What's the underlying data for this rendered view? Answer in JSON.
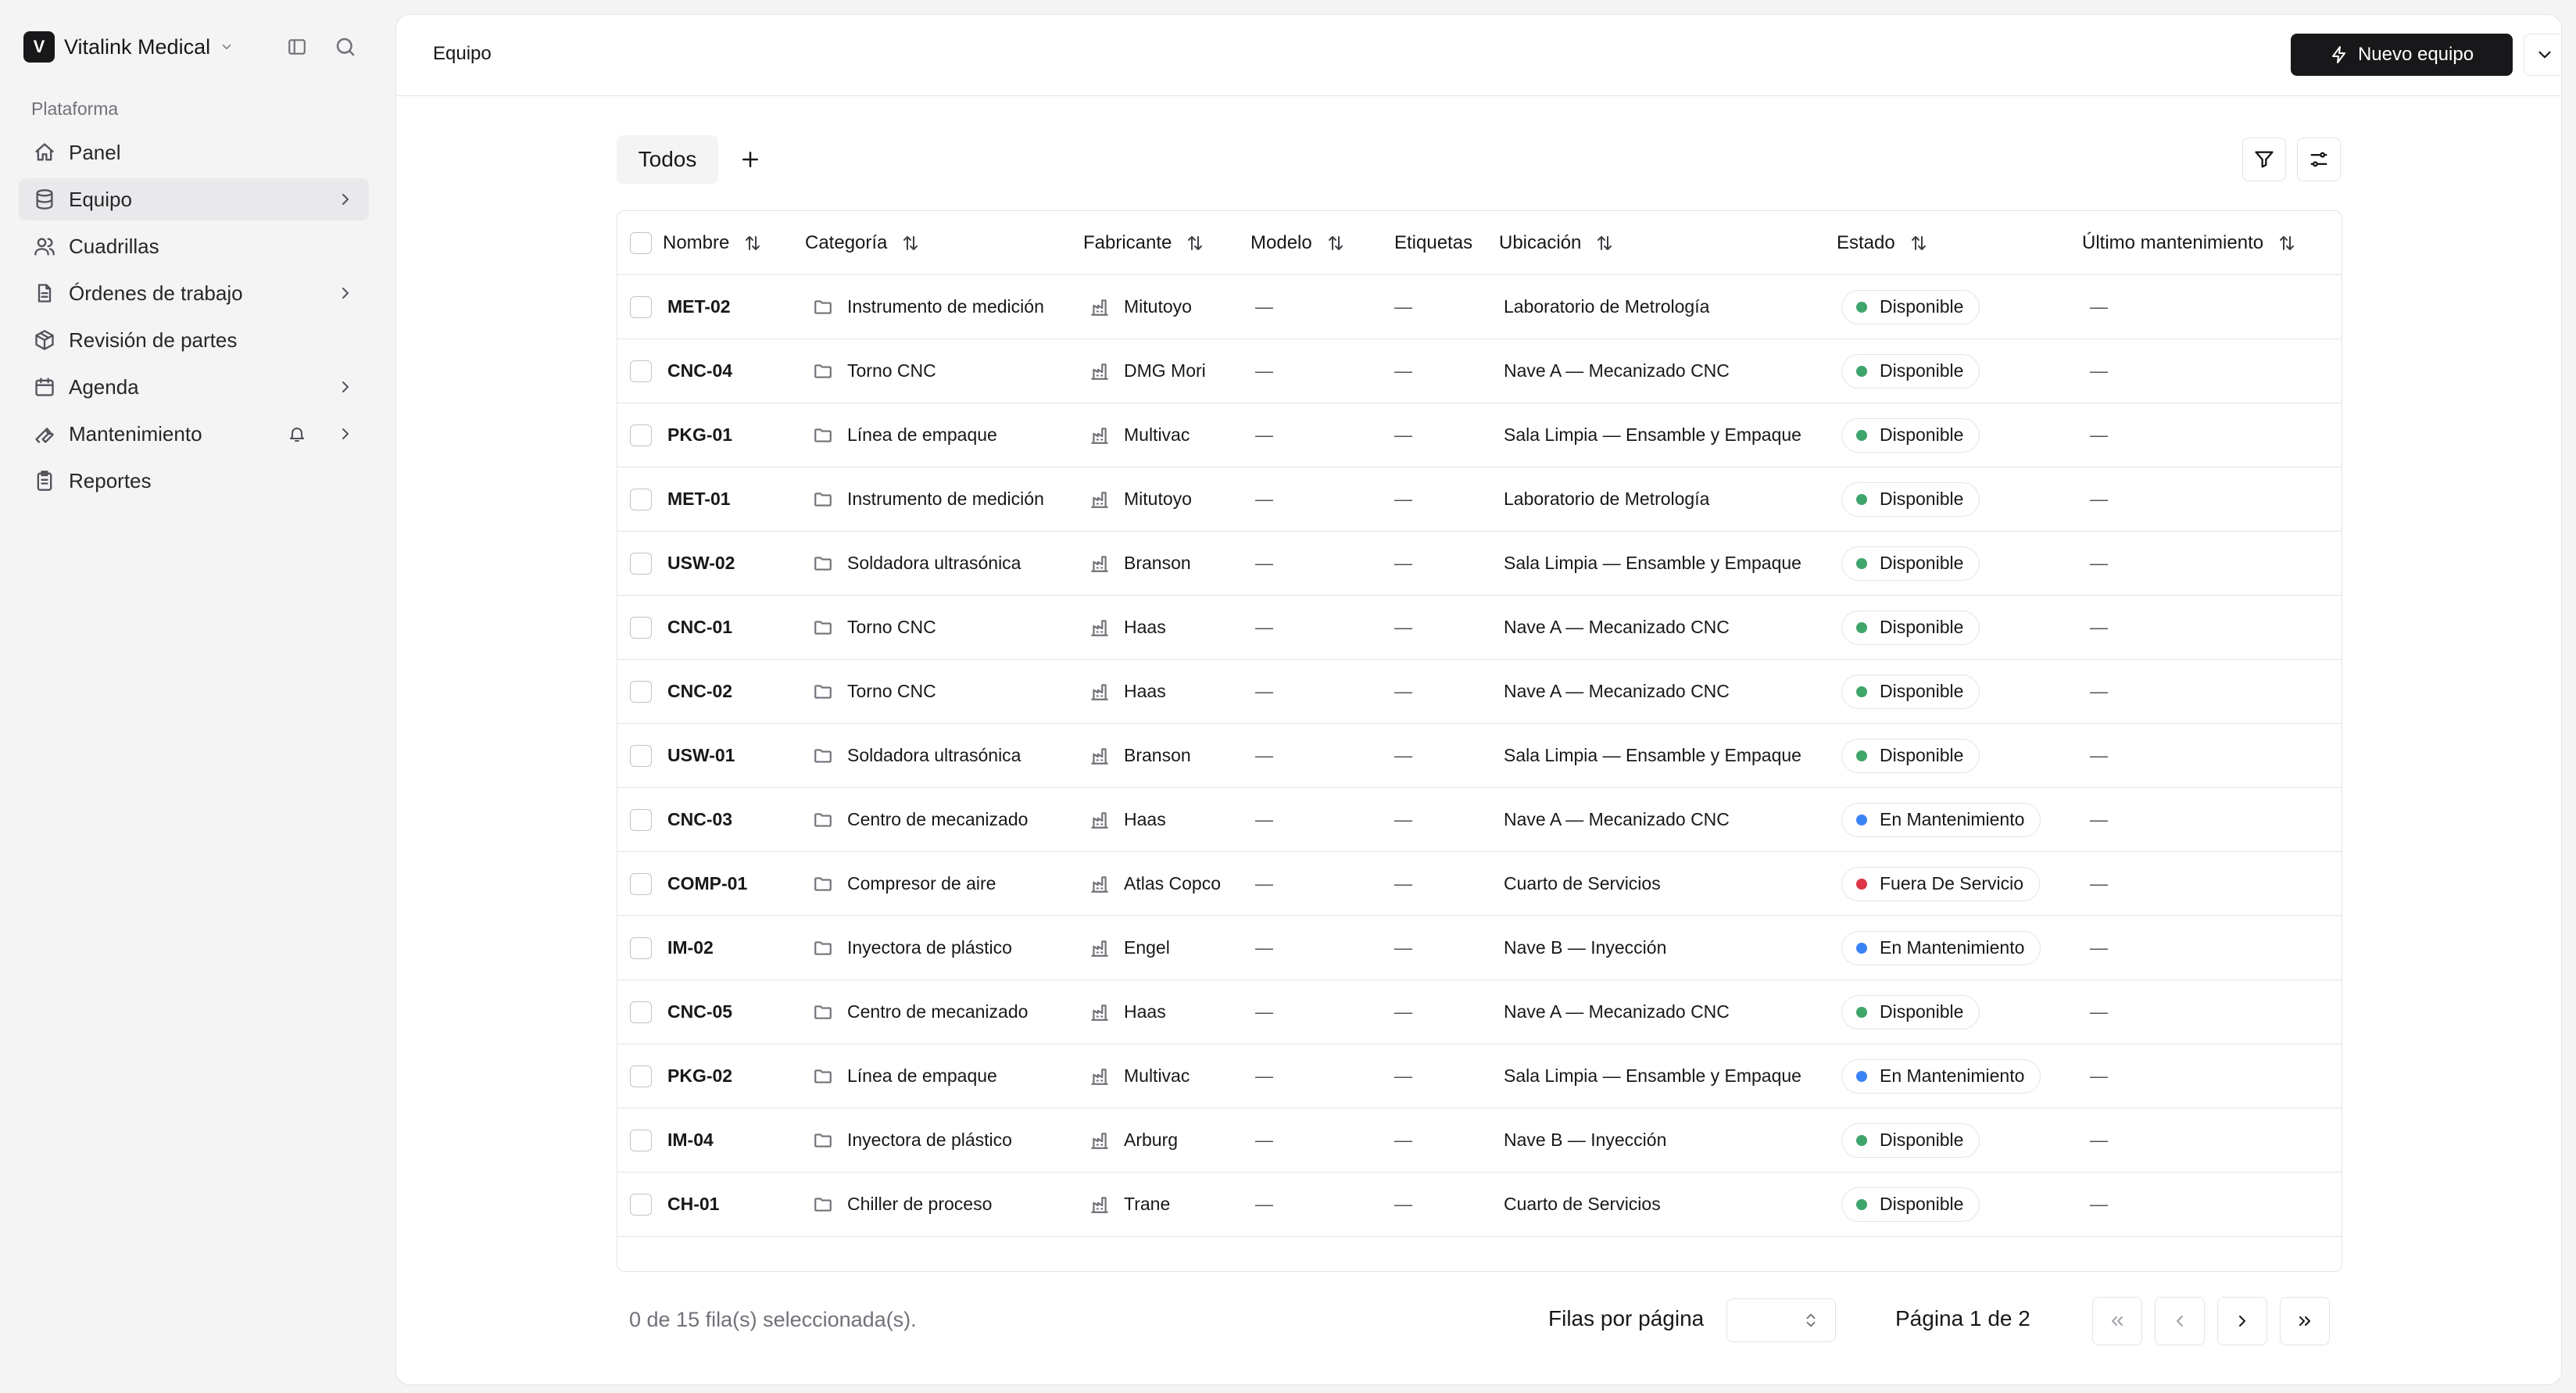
{
  "brand": {
    "initial": "V",
    "name": "Vitalink Medical"
  },
  "sidebar": {
    "section_label": "Plataforma",
    "items": [
      {
        "label": "Panel",
        "icon": "home-icon",
        "active": false,
        "chevron": false
      },
      {
        "label": "Equipo",
        "icon": "database-icon",
        "active": true,
        "chevron": true
      },
      {
        "label": "Cuadrillas",
        "icon": "users-icon",
        "active": false,
        "chevron": false
      },
      {
        "label": "Órdenes de trabajo",
        "icon": "file-text-icon",
        "active": false,
        "chevron": true
      },
      {
        "label": "Revisión de partes",
        "icon": "package-icon",
        "active": false,
        "chevron": false
      },
      {
        "label": "Agenda",
        "icon": "calendar-icon",
        "active": false,
        "chevron": true
      },
      {
        "label": "Mantenimiento",
        "icon": "wrench-icon",
        "active": false,
        "chevron": true,
        "bell": true
      },
      {
        "label": "Reportes",
        "icon": "clipboard-icon",
        "active": false,
        "chevron": false
      }
    ]
  },
  "header": {
    "breadcrumb": "Equipo",
    "new_button_label": "Nuevo equipo"
  },
  "view": {
    "tab_label": "Todos"
  },
  "table": {
    "columns": {
      "nombre": "Nombre",
      "categoria": "Categoría",
      "fabricante": "Fabricante",
      "modelo": "Modelo",
      "etiquetas": "Etiquetas",
      "ubicacion": "Ubicación",
      "estado": "Estado",
      "ultimo": "Último mantenimiento"
    },
    "rows": [
      {
        "nombre": "MET-02",
        "categoria": "Instrumento de medición",
        "fabricante": "Mitutoyo",
        "modelo": "—",
        "etiquetas": "—",
        "ubicacion": "Laboratorio de Metrología",
        "estado": "Disponible",
        "ultimo": "—"
      },
      {
        "nombre": "CNC-04",
        "categoria": "Torno CNC",
        "fabricante": "DMG Mori",
        "modelo": "—",
        "etiquetas": "—",
        "ubicacion": "Nave A — Mecanizado CNC",
        "estado": "Disponible",
        "ultimo": "—"
      },
      {
        "nombre": "PKG-01",
        "categoria": "Línea de empaque",
        "fabricante": "Multivac",
        "modelo": "—",
        "etiquetas": "—",
        "ubicacion": "Sala Limpia — Ensamble y Empaque",
        "estado": "Disponible",
        "ultimo": "—"
      },
      {
        "nombre": "MET-01",
        "categoria": "Instrumento de medición",
        "fabricante": "Mitutoyo",
        "modelo": "—",
        "etiquetas": "—",
        "ubicacion": "Laboratorio de Metrología",
        "estado": "Disponible",
        "ultimo": "—"
      },
      {
        "nombre": "USW-02",
        "categoria": "Soldadora ultrasónica",
        "fabricante": "Branson",
        "modelo": "—",
        "etiquetas": "—",
        "ubicacion": "Sala Limpia — Ensamble y Empaque",
        "estado": "Disponible",
        "ultimo": "—"
      },
      {
        "nombre": "CNC-01",
        "categoria": "Torno CNC",
        "fabricante": "Haas",
        "modelo": "—",
        "etiquetas": "—",
        "ubicacion": "Nave A — Mecanizado CNC",
        "estado": "Disponible",
        "ultimo": "—"
      },
      {
        "nombre": "CNC-02",
        "categoria": "Torno CNC",
        "fabricante": "Haas",
        "modelo": "—",
        "etiquetas": "—",
        "ubicacion": "Nave A — Mecanizado CNC",
        "estado": "Disponible",
        "ultimo": "—"
      },
      {
        "nombre": "USW-01",
        "categoria": "Soldadora ultrasónica",
        "fabricante": "Branson",
        "modelo": "—",
        "etiquetas": "—",
        "ubicacion": "Sala Limpia — Ensamble y Empaque",
        "estado": "Disponible",
        "ultimo": "—"
      },
      {
        "nombre": "CNC-03",
        "categoria": "Centro de mecanizado",
        "fabricante": "Haas",
        "modelo": "—",
        "etiquetas": "—",
        "ubicacion": "Nave A — Mecanizado CNC",
        "estado": "En Mantenimiento",
        "ultimo": "—"
      },
      {
        "nombre": "COMP-01",
        "categoria": "Compresor de aire",
        "fabricante": "Atlas Copco",
        "modelo": "—",
        "etiquetas": "—",
        "ubicacion": "Cuarto de Servicios",
        "estado": "Fuera De Servicio",
        "ultimo": "—"
      },
      {
        "nombre": "IM-02",
        "categoria": "Inyectora de plástico",
        "fabricante": "Engel",
        "modelo": "—",
        "etiquetas": "—",
        "ubicacion": "Nave B — Inyección",
        "estado": "En Mantenimiento",
        "ultimo": "—"
      },
      {
        "nombre": "CNC-05",
        "categoria": "Centro de mecanizado",
        "fabricante": "Haas",
        "modelo": "—",
        "etiquetas": "—",
        "ubicacion": "Nave A — Mecanizado CNC",
        "estado": "Disponible",
        "ultimo": "—"
      },
      {
        "nombre": "PKG-02",
        "categoria": "Línea de empaque",
        "fabricante": "Multivac",
        "modelo": "—",
        "etiquetas": "—",
        "ubicacion": "Sala Limpia — Ensamble y Empaque",
        "estado": "En Mantenimiento",
        "ultimo": "—"
      },
      {
        "nombre": "IM-04",
        "categoria": "Inyectora de plástico",
        "fabricante": "Arburg",
        "modelo": "—",
        "etiquetas": "—",
        "ubicacion": "Nave B — Inyección",
        "estado": "Disponible",
        "ultimo": "—"
      },
      {
        "nombre": "CH-01",
        "categoria": "Chiller de proceso",
        "fabricante": "Trane",
        "modelo": "—",
        "etiquetas": "—",
        "ubicacion": "Cuarto de Servicios",
        "estado": "Disponible",
        "ultimo": "—"
      }
    ]
  },
  "status_colors": {
    "Disponible": "#3fa56a",
    "En Mantenimiento": "#3b82f6",
    "Fuera De Servicio": "#dc3545"
  },
  "footer": {
    "selection_text": "0 de 15 fila(s) seleccionada(s).",
    "rows_per_page_label": "Filas por página",
    "rows_per_page_value": "",
    "page_info": "Página 1 de 2"
  }
}
